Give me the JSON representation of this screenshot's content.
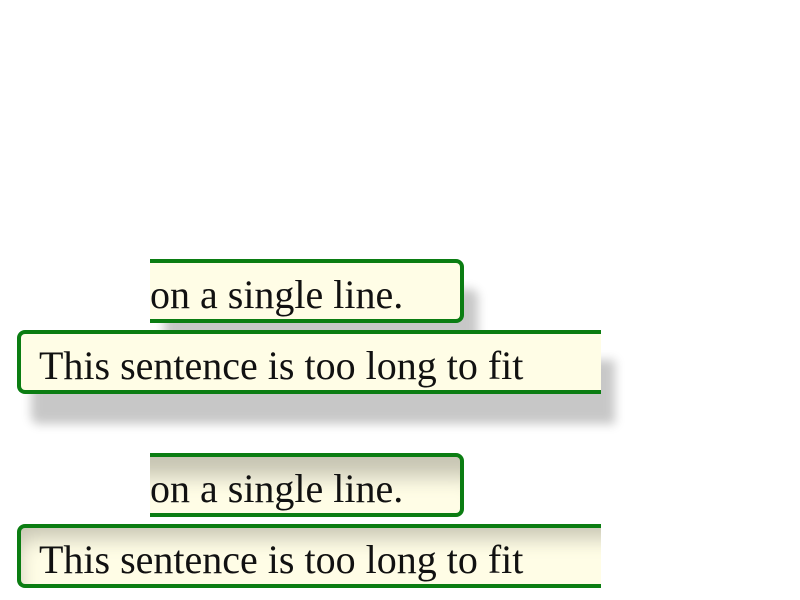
{
  "group1": {
    "ending_text": "on a single line.",
    "starting_text": "This sentence is too long to fit"
  },
  "group2": {
    "ending_text": "on a single line.",
    "starting_text": "This sentence is too long to fit"
  },
  "colors": {
    "border": "#0b7d12",
    "fill": "#fffde6",
    "text": "#111111"
  }
}
